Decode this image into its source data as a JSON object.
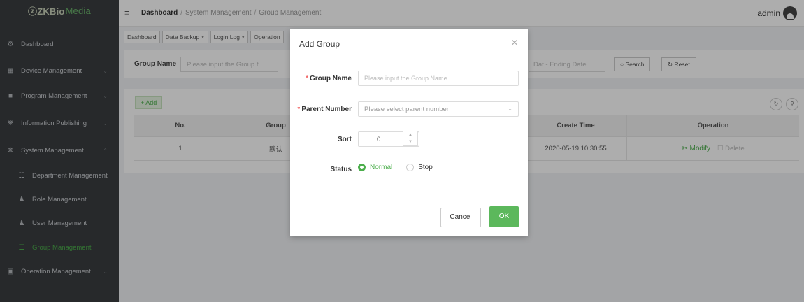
{
  "app": {
    "logo_prefix": "ⓩZKBio",
    "logo_suffix": "Media"
  },
  "sidebar": {
    "items": [
      {
        "label": "Dashboard",
        "icon": "dashboard-icon"
      },
      {
        "label": "Device Management",
        "icon": "device-icon"
      },
      {
        "label": "Program Management",
        "icon": "folder-icon"
      },
      {
        "label": "Information Publishing",
        "icon": "gear-icon"
      },
      {
        "label": "System Management",
        "icon": "gear-icon"
      },
      {
        "label": "Department Management",
        "icon": "org-icon"
      },
      {
        "label": "Role Management",
        "icon": "users-icon"
      },
      {
        "label": "User Management",
        "icon": "user-icon"
      },
      {
        "label": "Group Management",
        "icon": "list-icon"
      },
      {
        "label": "Operation Management",
        "icon": "monitor-icon"
      }
    ]
  },
  "header": {
    "breadcrumb": [
      "Dashboard",
      "System Management",
      "Group Management"
    ],
    "user": "admin"
  },
  "tabs": [
    "Dashboard",
    "Data Backup ×",
    "Login Log ×",
    "Operation"
  ],
  "search": {
    "group_name_label": "Group Name",
    "group_name_placeholder": "Please input the Group f",
    "date_placeholder": "Dat - Ending Date",
    "search_label": "○ Search",
    "reset_label": "↻ Reset"
  },
  "table": {
    "add_label": "+ Add",
    "headers": [
      "No.",
      "Group",
      "",
      "Create Time",
      "Operation"
    ],
    "rows": [
      {
        "no": "1",
        "group": "默认",
        "create_time": "2020-05-19 10:30:55",
        "modify": "✂ Modify",
        "delete": "☐ Delete"
      }
    ]
  },
  "modal": {
    "title": "Add Group",
    "fields": {
      "group_name_label": "Group Name",
      "group_name_placeholder": "Please input the Group Name",
      "parent_number_label": "Parent Number",
      "parent_number_placeholder": "Please select parent number",
      "sort_label": "Sort",
      "sort_value": "0",
      "status_label": "Status",
      "status_options": [
        "Normal",
        "Stop"
      ],
      "status_selected": "Normal"
    },
    "cancel_label": "Cancel",
    "ok_label": "OK"
  },
  "colors": {
    "accent": "#5cb85c",
    "sidebar_bg": "#3a3d40"
  }
}
